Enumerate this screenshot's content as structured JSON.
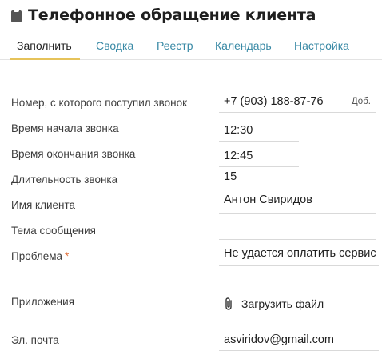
{
  "header": {
    "title": "Телефонное обращение клиента",
    "icon": "clipboard-icon"
  },
  "tabs": [
    {
      "label": "Заполнить",
      "active": true
    },
    {
      "label": "Сводка",
      "active": false
    },
    {
      "label": "Реестр",
      "active": false
    },
    {
      "label": "Календарь",
      "active": false
    },
    {
      "label": "Настройка",
      "active": false
    }
  ],
  "form": {
    "phone": {
      "label": "Номер, с которого поступил звонок",
      "value": "+7 (903) 188-87-76",
      "ext_label": "Доб."
    },
    "start_time": {
      "label": "Время начала звонка",
      "value": "12:30"
    },
    "end_time": {
      "label": "Время окончания звонка",
      "value": "12:45"
    },
    "duration": {
      "label": "Длительность звонка",
      "value": "15"
    },
    "client_name": {
      "label": "Имя клиента",
      "value": "Антон Свиридов"
    },
    "topic": {
      "label": "Тема сообщения",
      "value": ""
    },
    "problem": {
      "label": "Проблема",
      "required_mark": "*",
      "value": "Не удается оплатить сервис"
    },
    "attachments": {
      "label": "Приложения",
      "upload_label": "Загрузить файл",
      "icon": "paperclip-icon"
    },
    "email": {
      "label": "Эл. почта",
      "value": "asviridov@gmail.com"
    }
  },
  "colors": {
    "accent_tab": "#3a8aa6",
    "active_underline": "#e6c35a",
    "required": "#e0703a"
  }
}
